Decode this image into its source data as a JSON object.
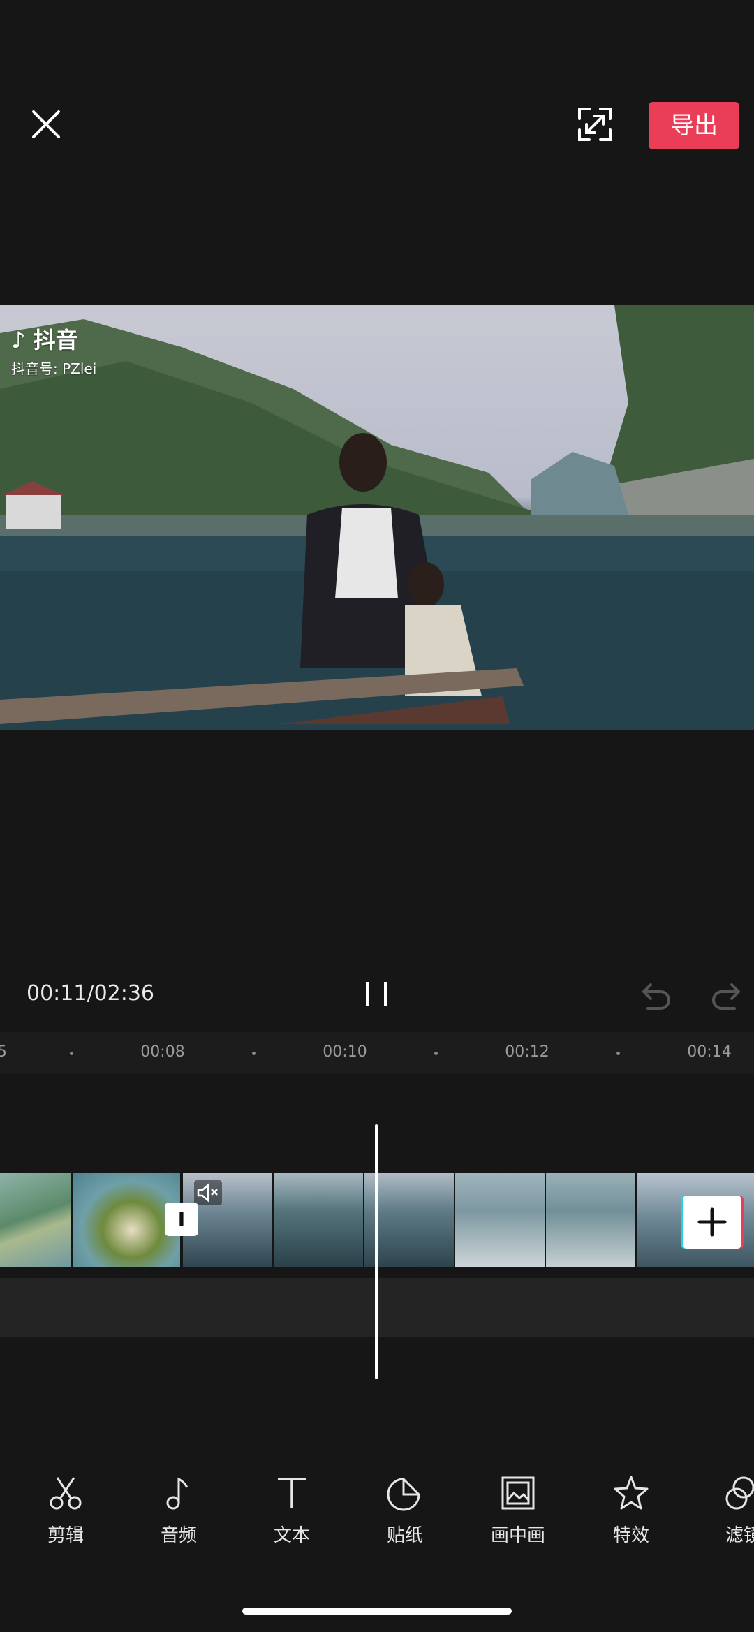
{
  "topbar": {
    "export_label": "导出"
  },
  "video": {
    "watermark_app": "抖音",
    "watermark_id": "抖音号: PZlei"
  },
  "playback": {
    "timecode": "00:11/02:36"
  },
  "ruler": {
    "labels": [
      "00:08",
      "00:10",
      "00:12",
      "00:14"
    ]
  },
  "tools": [
    {
      "label": "剪辑",
      "icon": "scissors-icon"
    },
    {
      "label": "音频",
      "icon": "music-note-icon"
    },
    {
      "label": "文本",
      "icon": "text-icon"
    },
    {
      "label": "贴纸",
      "icon": "sticker-icon"
    },
    {
      "label": "画中画",
      "icon": "picture-in-picture-icon"
    },
    {
      "label": "特效",
      "icon": "star-effect-icon"
    },
    {
      "label": "滤镜",
      "icon": "filter-icon"
    }
  ],
  "colors": {
    "accent": "#ea3d57",
    "background": "#161616"
  }
}
